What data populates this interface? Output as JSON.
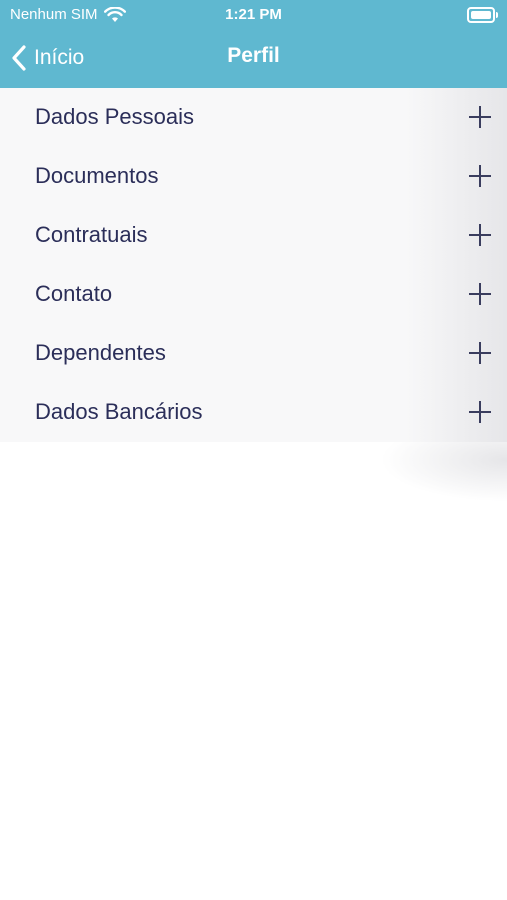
{
  "status_bar": {
    "carrier": "Nenhum SIM",
    "time": "1:21 PM"
  },
  "nav": {
    "back_label": "Início",
    "title": "Perfil"
  },
  "sections": [
    {
      "label": "Dados Pessoais"
    },
    {
      "label": "Documentos"
    },
    {
      "label": "Contratuais"
    },
    {
      "label": "Contato"
    },
    {
      "label": "Dependentes"
    },
    {
      "label": "Dados Bancários"
    }
  ],
  "colors": {
    "header_bg": "#5fb8d0",
    "row_text": "#2b2e59",
    "row_bg": "#f8f8f9"
  },
  "icons": {
    "wifi": "wifi-icon",
    "battery": "battery-icon",
    "back": "chevron-left-icon",
    "expand": "plus-icon"
  }
}
